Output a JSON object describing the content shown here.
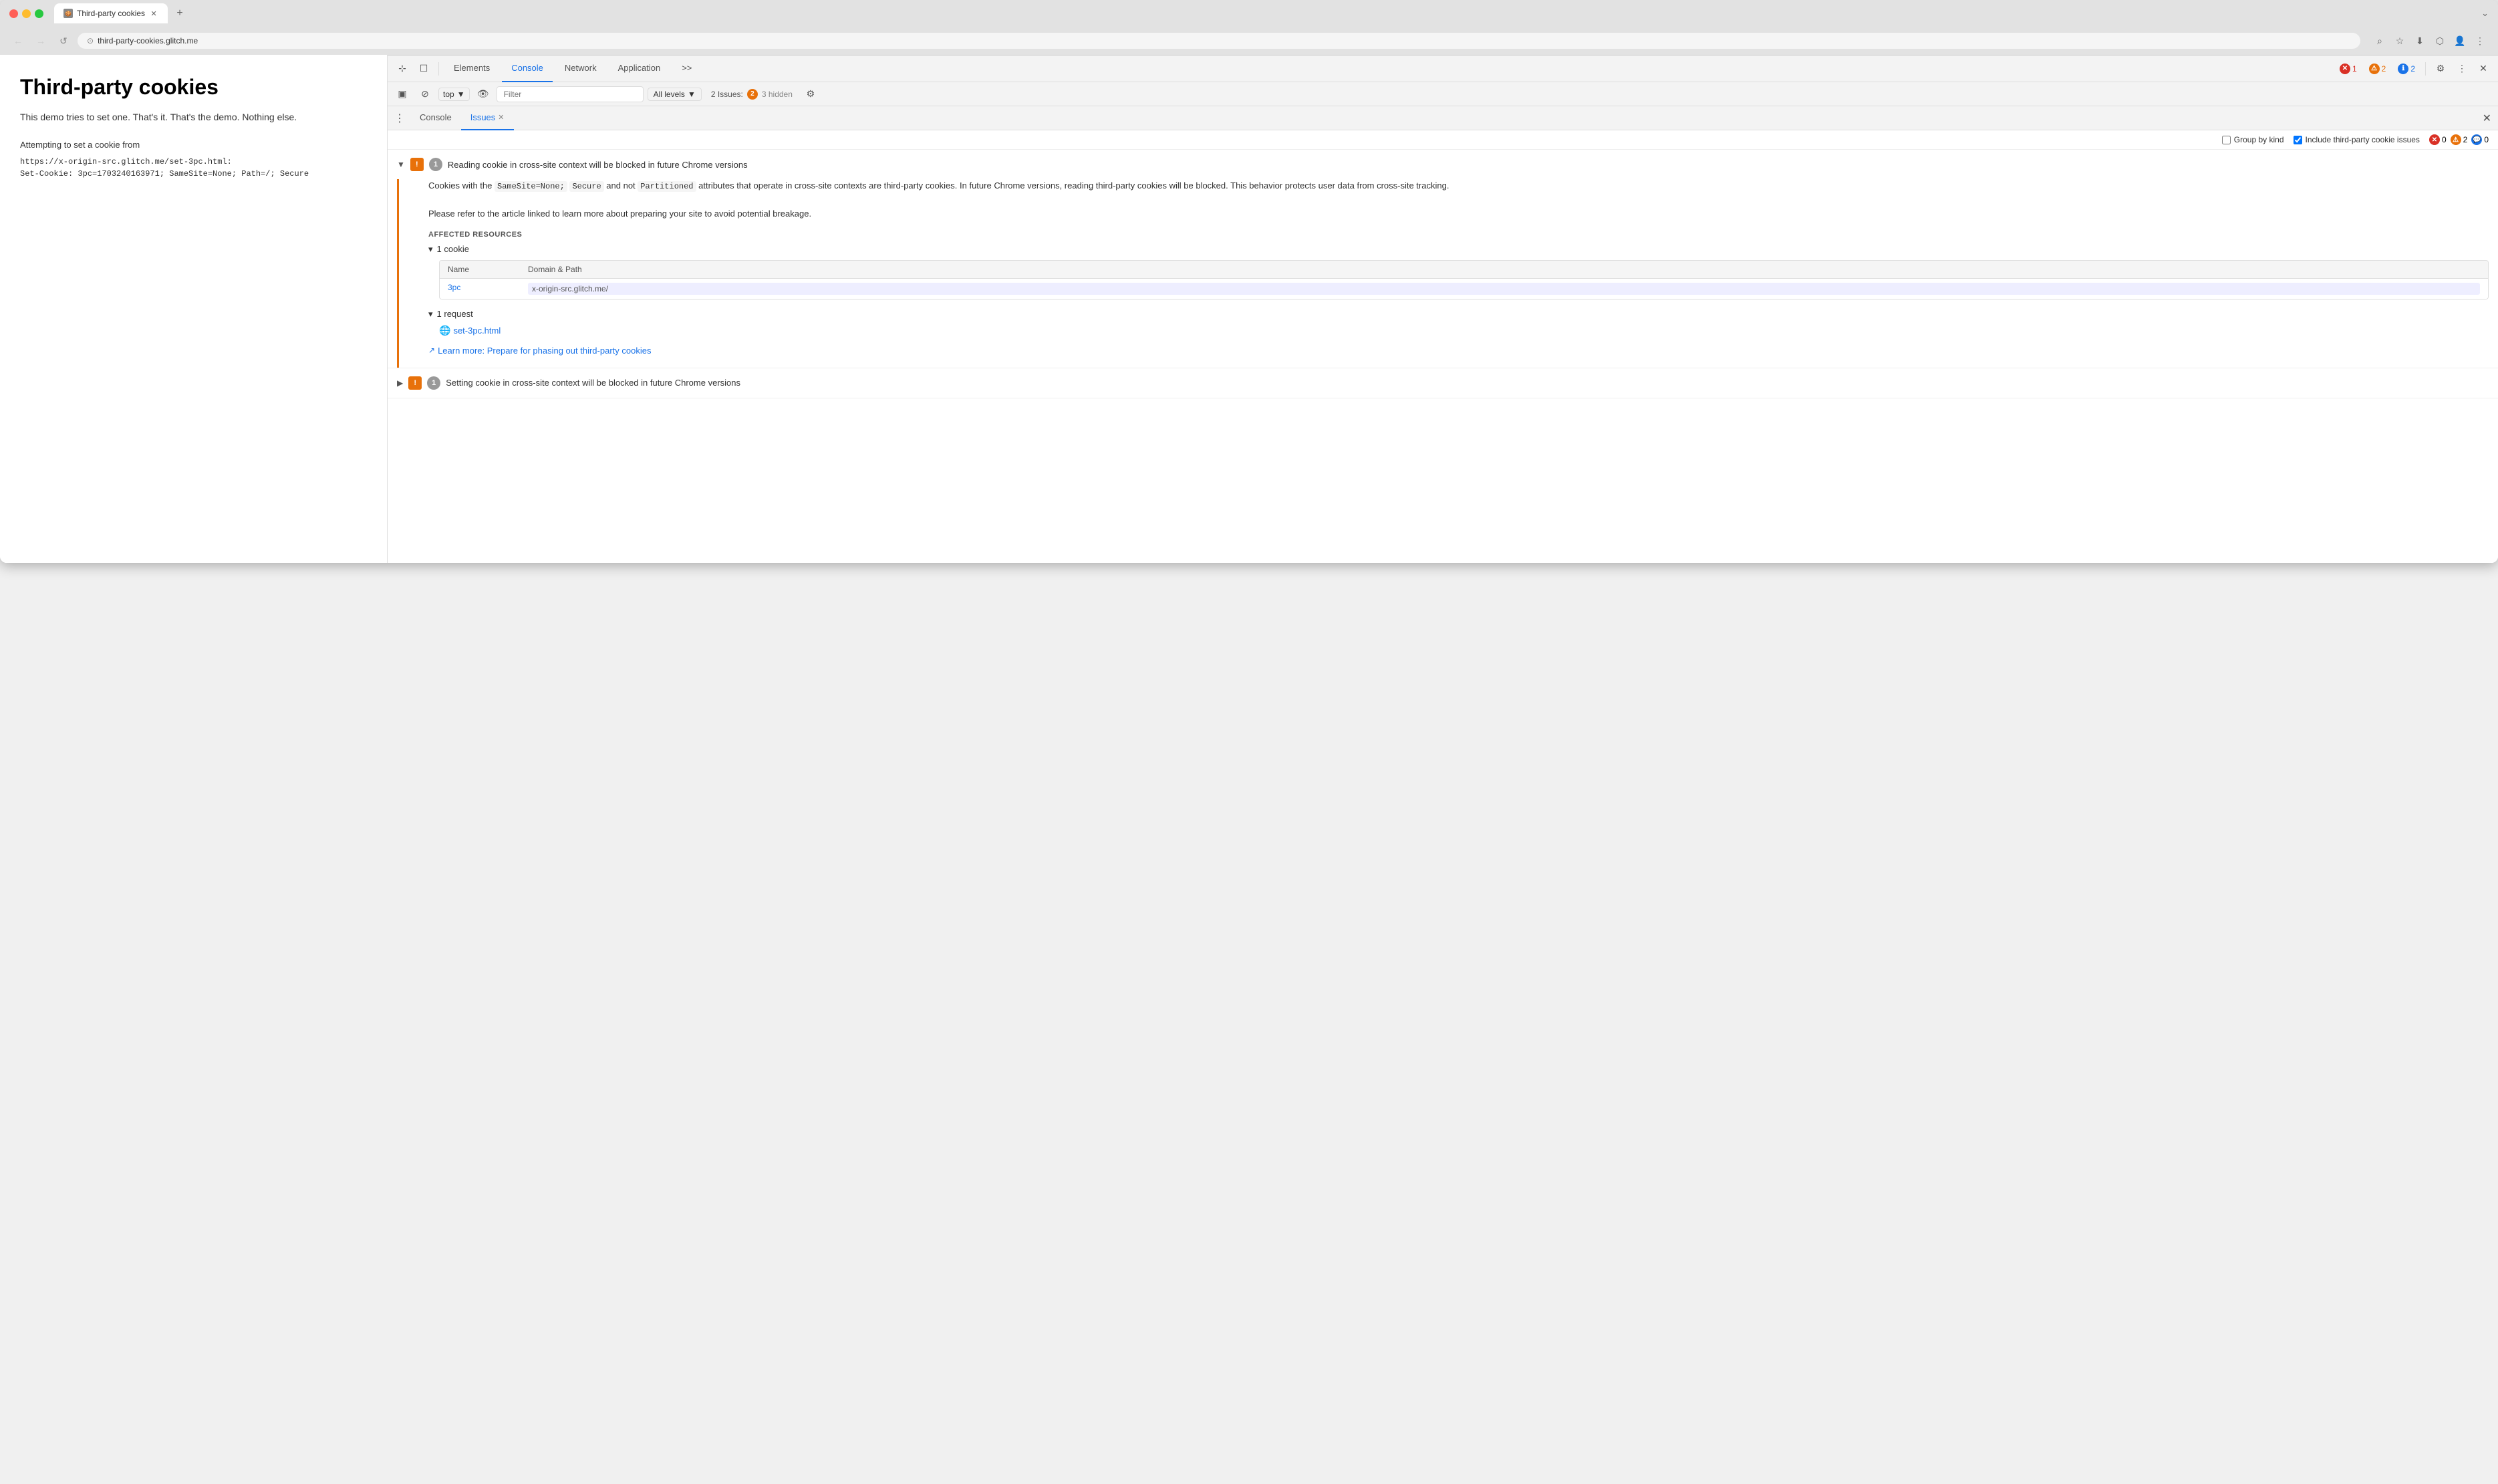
{
  "browser": {
    "tab_title": "Third-party cookies",
    "url": "third-party-cookies.glitch.me",
    "favicon_label": "🍪"
  },
  "page": {
    "title": "Third-party cookies",
    "subtitle": "This demo tries to set one. That's it. That's the demo. Nothing else.",
    "body_attempting": "Attempting to set a cookie from",
    "body_code1": "https://x-origin-src.glitch.me/set-3pc.html:",
    "body_code2": "Set-Cookie: 3pc=1703240163971; SameSite=None; Path=/; Secure"
  },
  "devtools": {
    "toolbar": {
      "elements_label": "Elements",
      "console_label": "Console",
      "network_label": "Network",
      "application_label": "Application",
      "more_label": ">>",
      "error_count": "1",
      "warn_count": "2",
      "info_count": "2",
      "close_label": "✕"
    },
    "console_bar": {
      "top_label": "top",
      "filter_placeholder": "Filter",
      "levels_label": "All levels",
      "issues_label": "2 Issues:",
      "hidden_count": "3 hidden"
    },
    "issues_panel": {
      "console_tab": "Console",
      "issues_tab": "Issues",
      "group_by_kind_label": "Group by kind",
      "include_third_party_label": "Include third-party cookie issues",
      "error_count": "0",
      "warn_count": "2",
      "info_count": "0",
      "issue1": {
        "count": "1",
        "title": "Reading cookie in cross-site context will be blocked in future Chrome versions",
        "description1": "Cookies with the",
        "code1": "SameSite=None;",
        "description2": "Secure",
        "code2": "and not",
        "code3": "Partitioned",
        "description3": "attributes that operate in cross-site contexts are third-party cookies. In future Chrome versions, reading third-party cookies will be blocked. This behavior protects user data from cross-site tracking.",
        "description4": "Please refer to the article linked to learn more about preparing your site to avoid potential breakage.",
        "affected_title": "AFFECTED RESOURCES",
        "cookie_count": "1 cookie",
        "table_header_name": "Name",
        "table_header_domain": "Domain & Path",
        "cookie_name": "3pc",
        "cookie_domain": "x-origin-src.glitch.me/",
        "request_count": "1 request",
        "request_link": "set-3pc.html",
        "learn_more_text": "Learn more: Prepare for phasing out third-party cookies"
      },
      "issue2": {
        "count": "1",
        "title": "Setting cookie in cross-site context will be blocked in future Chrome versions"
      }
    }
  },
  "icons": {
    "cursor_icon": "⊹",
    "device_icon": "⬜",
    "ban_icon": "⊘",
    "eye_icon": "👁",
    "gear_icon": "⚙",
    "more_icon": "⋮",
    "back_icon": "←",
    "forward_icon": "→",
    "refresh_icon": "↺",
    "secure_icon": "⊙",
    "zoom_icon": "⌕",
    "star_icon": "☆",
    "download_icon": "⬇",
    "extension_icon": "⬡",
    "expand_icon": "▼",
    "collapse_icon": "▶",
    "external_icon": "↗",
    "globe_icon": "🌐"
  }
}
